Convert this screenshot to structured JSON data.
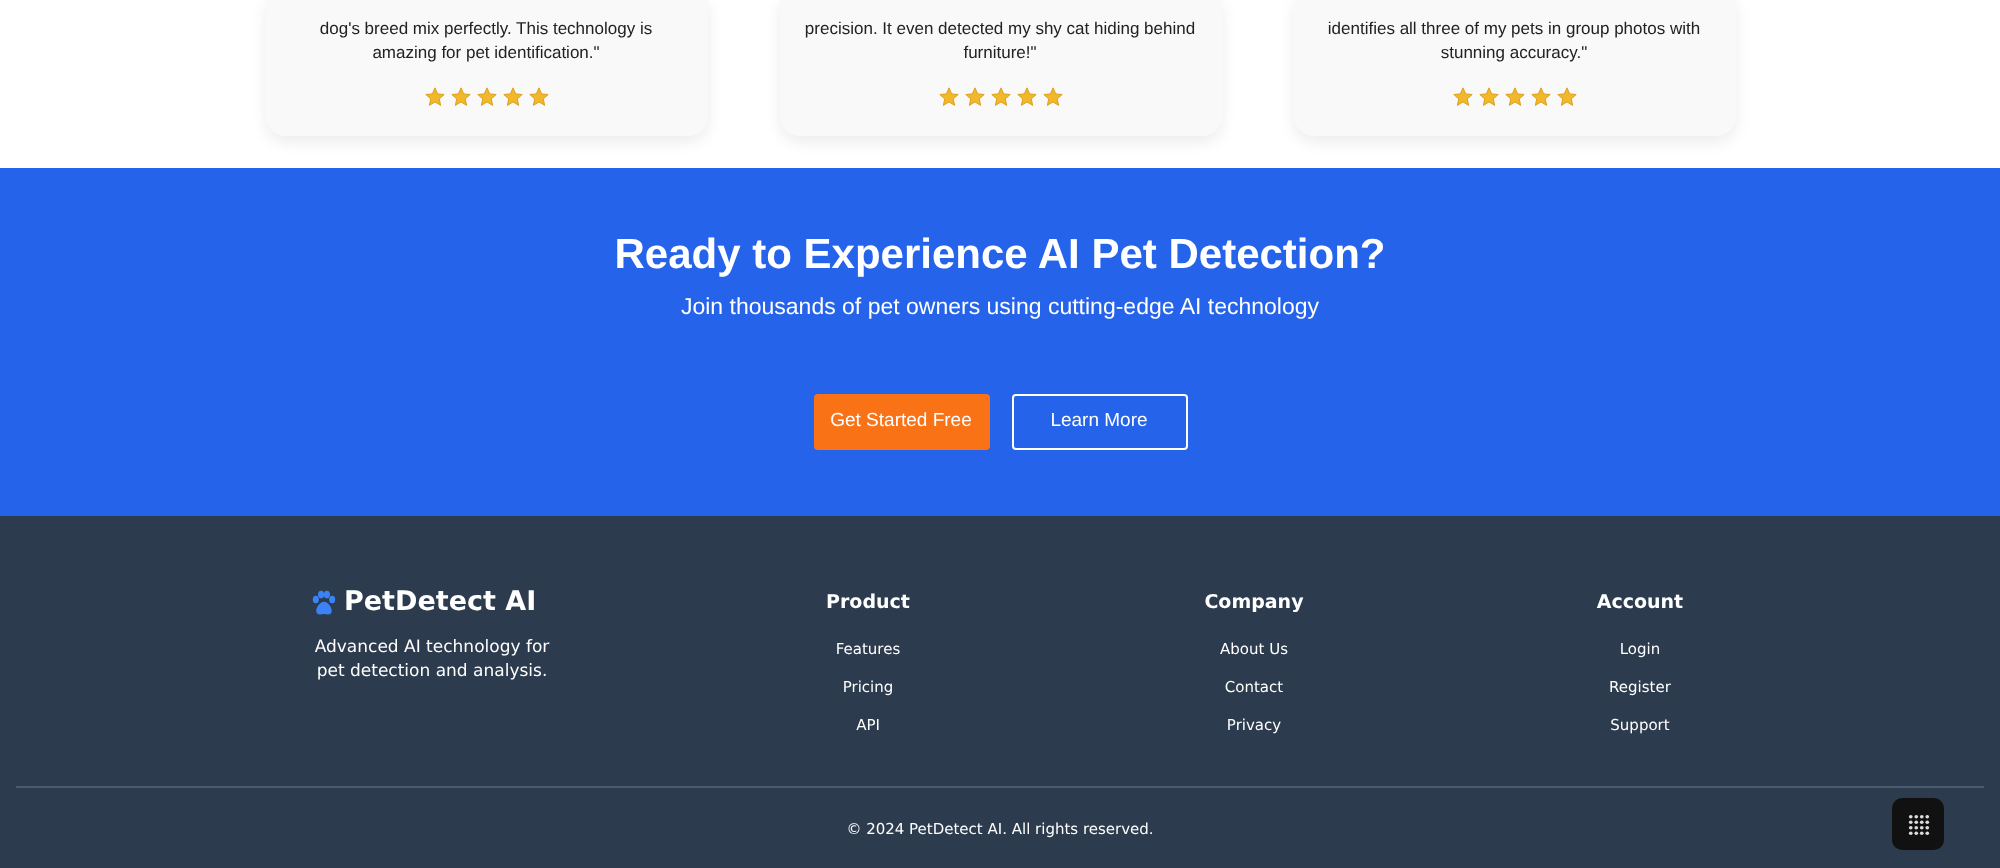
{
  "testimonials": [
    {
      "quote": "dog's breed mix perfectly. This technology is amazing for pet identification.\"",
      "stars": 5
    },
    {
      "quote": "precision. It even detected my shy cat hiding behind furniture!\"",
      "stars": 5
    },
    {
      "quote": "identifies all three of my pets in group photos with stunning accuracy.\"",
      "stars": 5
    }
  ],
  "cta": {
    "title": "Ready to Experience AI Pet Detection?",
    "subtitle": "Join thousands of pet owners using cutting-edge AI technology",
    "buttons": [
      {
        "kind": "primary",
        "label": "Get Started Free"
      },
      {
        "kind": "outline",
        "label": "Learn More"
      }
    ]
  },
  "footer": {
    "brand": "PetDetect AI",
    "description": "Advanced AI technology for pet detection and analysis.",
    "columns": [
      {
        "title": "Product",
        "links": [
          "Features",
          "Pricing",
          "API"
        ]
      },
      {
        "title": "Company",
        "links": [
          "About Us",
          "Contact",
          "Privacy"
        ]
      },
      {
        "title": "Account",
        "links": [
          "Login",
          "Register",
          "Support"
        ]
      }
    ],
    "copyright": "© 2024 PetDetect AI. All rights reserved."
  }
}
